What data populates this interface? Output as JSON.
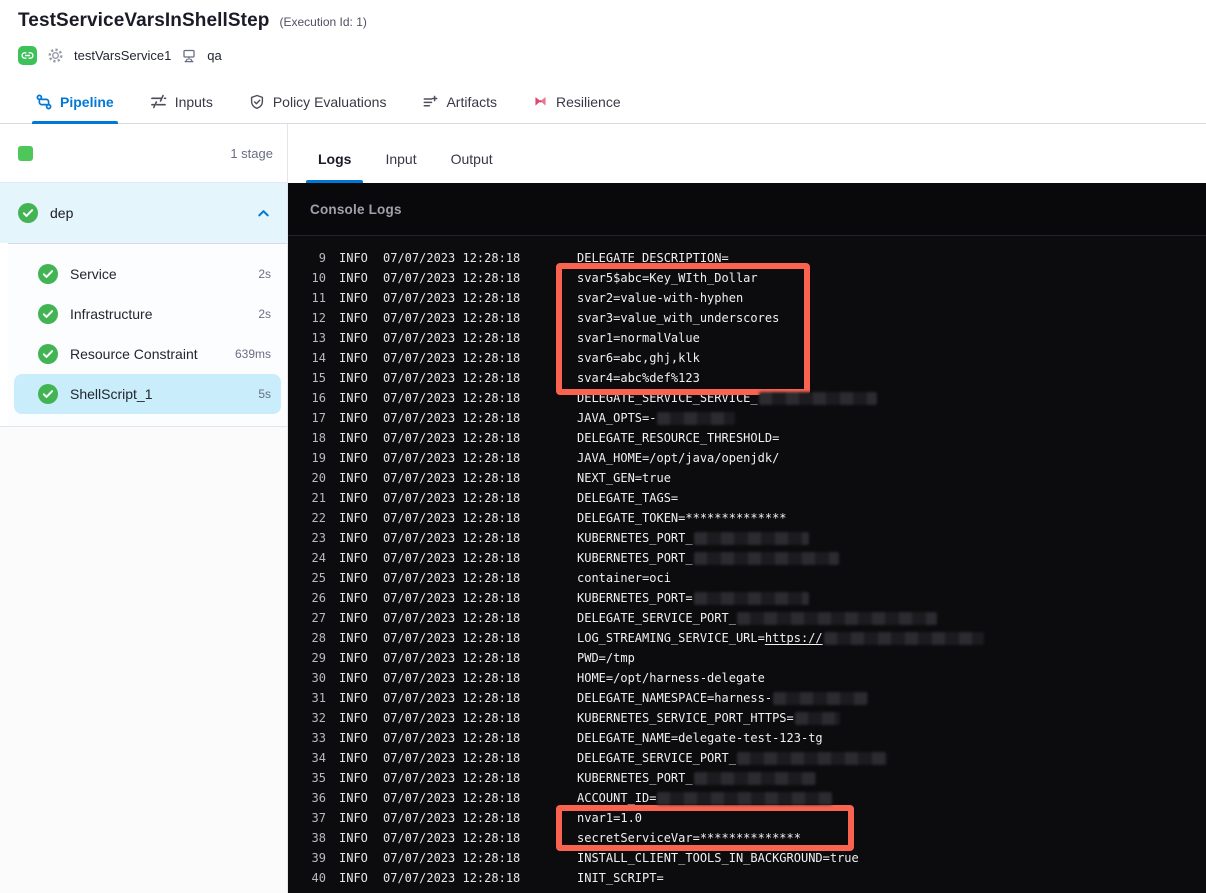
{
  "header": {
    "title": "TestServiceVarsInShellStep",
    "execution_id": "(Execution Id: 1)",
    "service_name": "testVarsService1",
    "environment_name": "qa"
  },
  "main_tabs": [
    {
      "label": "Pipeline",
      "active": true,
      "icon": "pipeline-icon",
      "accent": "#0278d5"
    },
    {
      "label": "Inputs",
      "active": false,
      "icon": "inputs-icon"
    },
    {
      "label": "Policy Evaluations",
      "active": false,
      "icon": "policy-shield-icon"
    },
    {
      "label": "Artifacts",
      "active": false,
      "icon": "artifacts-icon"
    },
    {
      "label": "Resilience",
      "active": false,
      "icon": "resilience-icon",
      "icon_color": "#e0476e"
    }
  ],
  "sidebar": {
    "stage_count": "1 stage",
    "stage_status_color": "#4ec75a",
    "group": {
      "label": "dep",
      "status": "success",
      "expanded": true
    },
    "steps": [
      {
        "label": "Service",
        "duration": "2s",
        "status": "success",
        "selected": false
      },
      {
        "label": "Infrastructure",
        "duration": "2s",
        "status": "success",
        "selected": false
      },
      {
        "label": "Resource Constraint",
        "duration": "639ms",
        "status": "success",
        "selected": false
      },
      {
        "label": "ShellScript_1",
        "duration": "5s",
        "status": "success",
        "selected": true
      }
    ]
  },
  "log_tabs": [
    {
      "label": "Logs",
      "active": true
    },
    {
      "label": "Input",
      "active": false
    },
    {
      "label": "Output",
      "active": false
    }
  ],
  "console": {
    "title": "Console Logs",
    "level": "INFO",
    "timestamp": "07/07/2023 12:28:18",
    "highlight_color": "#f96350",
    "lines": [
      {
        "n": 9,
        "text": "DELEGATE_DESCRIPTION="
      },
      {
        "n": 10,
        "text": "svar5$abc=Key_WIth_Dollar",
        "hl": 1
      },
      {
        "n": 11,
        "text": "svar2=value-with-hyphen",
        "hl": 1
      },
      {
        "n": 12,
        "text": "svar3=value_with_underscores",
        "hl": 1
      },
      {
        "n": 13,
        "text": "svar1=normalValue",
        "hl": 1
      },
      {
        "n": 14,
        "text": "svar6=abc,ghj,klk",
        "hl": 1
      },
      {
        "n": 15,
        "text": "svar4=abc%def%123",
        "hl": 1
      },
      {
        "n": 16,
        "text": "DELEGATE_SERVICE_SERVICE_",
        "redact": 118
      },
      {
        "n": 17,
        "text": "JAVA_OPTS=-",
        "redact": 78
      },
      {
        "n": 18,
        "text": "DELEGATE_RESOURCE_THRESHOLD="
      },
      {
        "n": 19,
        "text": "JAVA_HOME=/opt/java/openjdk/"
      },
      {
        "n": 20,
        "text": "NEXT_GEN=true"
      },
      {
        "n": 21,
        "text": "DELEGATE_TAGS="
      },
      {
        "n": 22,
        "text": "DELEGATE_TOKEN=**************"
      },
      {
        "n": 23,
        "text": "KUBERNETES_PORT_",
        "redact": 115
      },
      {
        "n": 24,
        "text": "KUBERNETES_PORT_",
        "redact": 145
      },
      {
        "n": 25,
        "text": "container=oci"
      },
      {
        "n": 26,
        "text": "KUBERNETES_PORT=",
        "redact": 115
      },
      {
        "n": 27,
        "text": "DELEGATE_SERVICE_PORT_",
        "redact": 200
      },
      {
        "n": 28,
        "text": "LOG_STREAMING_SERVICE_URL=",
        "link": "https://",
        "redact": 160
      },
      {
        "n": 29,
        "text": "PWD=/tmp"
      },
      {
        "n": 30,
        "text": "HOME=/opt/harness-delegate"
      },
      {
        "n": 31,
        "text": "DELEGATE_NAMESPACE=harness-",
        "redact": 95
      },
      {
        "n": 32,
        "text": "KUBERNETES_SERVICE_PORT_HTTPS=",
        "redact": 45
      },
      {
        "n": 33,
        "text": "DELEGATE_NAME=delegate-test-123-tg"
      },
      {
        "n": 34,
        "text": "DELEGATE_SERVICE_PORT_",
        "redact": 150
      },
      {
        "n": 35,
        "text": "KUBERNETES_PORT_",
        "redact": 122
      },
      {
        "n": 36,
        "text": "ACCOUNT_ID=",
        "redact": 175
      },
      {
        "n": 37,
        "text": "nvar1=1.0",
        "hl": 2
      },
      {
        "n": 38,
        "text": "secretServiceVar=**************",
        "hl": 2
      },
      {
        "n": 39,
        "text": "INSTALL_CLIENT_TOOLS_IN_BACKGROUND=true"
      },
      {
        "n": 40,
        "text": "INIT_SCRIPT="
      }
    ]
  }
}
